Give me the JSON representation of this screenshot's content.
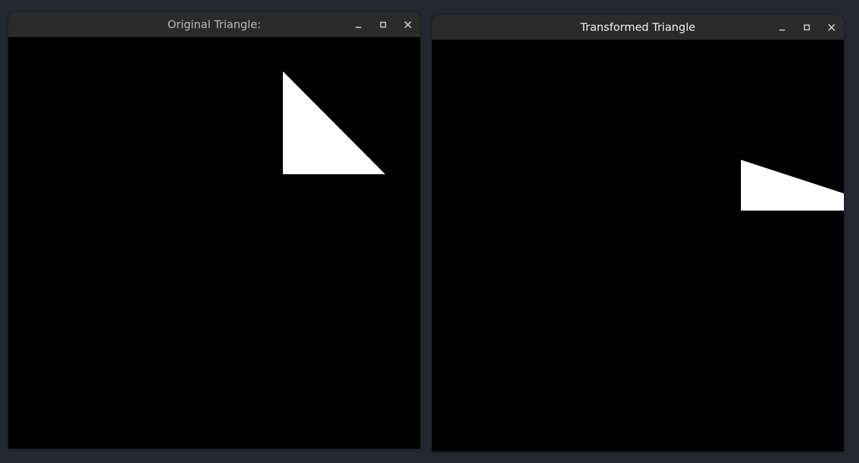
{
  "colors": {
    "desktop": "#252830",
    "titlebar": "#2b2b2b",
    "canvas": "#000000",
    "shape": "#ffffff",
    "control_icon": "#d0d0d0"
  },
  "windows": [
    {
      "title": "Original Triangle:",
      "controls": [
        "minimize-icon",
        "maximize-icon",
        "close-icon"
      ]
    },
    {
      "title": "Transformed Triangle",
      "controls": [
        "minimize-icon",
        "maximize-icon",
        "close-icon"
      ]
    }
  ]
}
